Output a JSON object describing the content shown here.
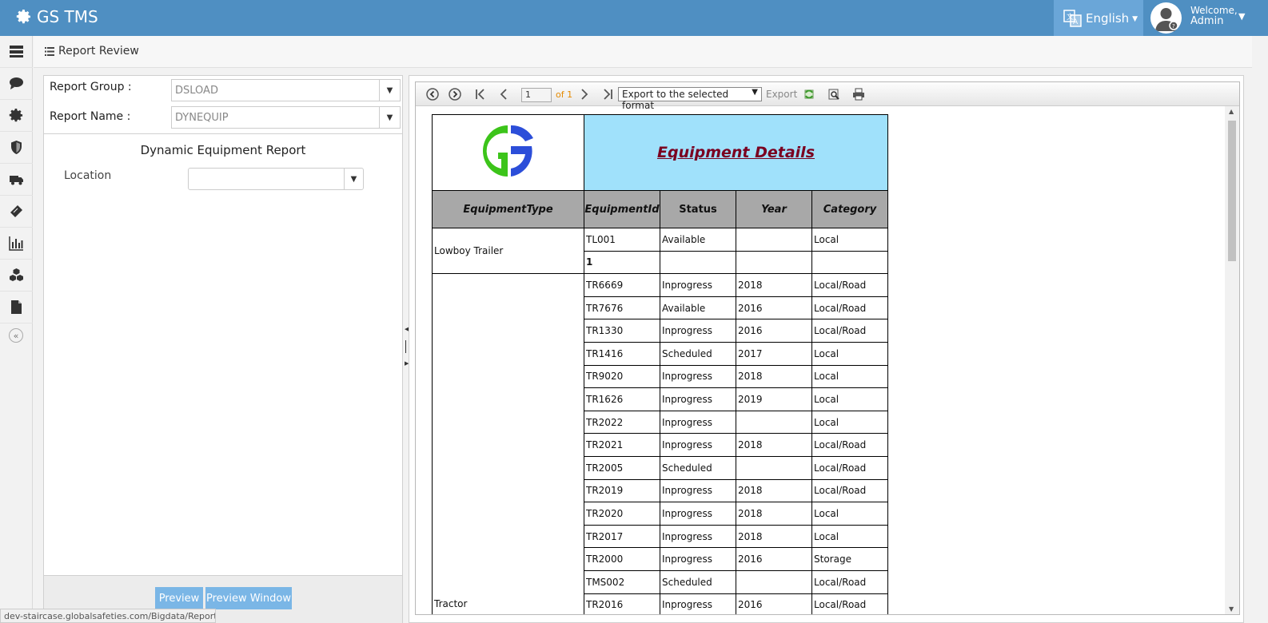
{
  "app": {
    "title": "GS TMS"
  },
  "header": {
    "language": "English",
    "welcome": "Welcome,",
    "user": "Admin"
  },
  "page": {
    "title": "Report Review"
  },
  "sidebar": {
    "items": [
      {
        "icon": "dashboard-icon"
      },
      {
        "icon": "chat-icon"
      },
      {
        "icon": "gear-icon"
      },
      {
        "icon": "shield-icon"
      },
      {
        "icon": "truck-icon"
      },
      {
        "icon": "ticket-icon"
      },
      {
        "icon": "bar-chart-icon"
      },
      {
        "icon": "boxes-icon"
      },
      {
        "icon": "document-icon"
      }
    ],
    "collapse": "«"
  },
  "form": {
    "report_group_label": "Report Group :",
    "report_group_value": "DSLOAD",
    "report_name_label": "Report Name :",
    "report_name_value": "DYNEQUIP",
    "report_title": "Dynamic Equipment Report",
    "location_label": "Location",
    "location_value": "",
    "preview": "Preview",
    "preview_window": "Preview Window"
  },
  "status_url": "dev-staircase.globalsafeties.com/Bigdata/Report#",
  "viewer": {
    "page": "1",
    "of": "of 1",
    "export_select": "Export to the selected format",
    "export": "Export"
  },
  "report": {
    "title": "Equipment Details",
    "columns": [
      "EquipmentType",
      "EquipmentId",
      "Status",
      "Year",
      "Category"
    ],
    "groups": [
      {
        "type": "Lowboy Trailer",
        "rows": [
          {
            "id": "TL001",
            "status": "Available",
            "year": "",
            "category": "Local"
          },
          {
            "id": "1",
            "status": "",
            "year": "",
            "category": "",
            "bold": true
          }
        ]
      },
      {
        "type": "Tractor",
        "rows": [
          {
            "id": "TR6669",
            "status": "Inprogress",
            "year": "2018",
            "category": "Local/Road"
          },
          {
            "id": "TR7676",
            "status": "Available",
            "year": "2016",
            "category": "Local/Road"
          },
          {
            "id": "TR1330",
            "status": "Inprogress",
            "year": "2016",
            "category": "Local/Road"
          },
          {
            "id": "TR1416",
            "status": "Scheduled",
            "year": "2017",
            "category": "Local"
          },
          {
            "id": "TR9020",
            "status": "Inprogress",
            "year": "2018",
            "category": "Local"
          },
          {
            "id": "TR1626",
            "status": "Inprogress",
            "year": "2019",
            "category": "Local"
          },
          {
            "id": "TR2022",
            "status": "Inprogress",
            "year": "",
            "category": "Local"
          },
          {
            "id": "TR2021",
            "status": "Inprogress",
            "year": "2018",
            "category": "Local/Road"
          },
          {
            "id": "TR2005",
            "status": "Scheduled",
            "year": "",
            "category": "Local/Road"
          },
          {
            "id": "TR2019",
            "status": "Inprogress",
            "year": "2018",
            "category": "Local/Road"
          },
          {
            "id": "TR2020",
            "status": "Inprogress",
            "year": "2018",
            "category": "Local"
          },
          {
            "id": "TR2017",
            "status": "Inprogress",
            "year": "2018",
            "category": "Local"
          },
          {
            "id": "TR2000",
            "status": "Inprogress",
            "year": "2016",
            "category": "Storage"
          },
          {
            "id": "TMS002",
            "status": "Scheduled",
            "year": "",
            "category": "Local/Road"
          },
          {
            "id": "TR2016",
            "status": "Inprogress",
            "year": "2016",
            "category": "Local/Road"
          }
        ]
      }
    ]
  }
}
